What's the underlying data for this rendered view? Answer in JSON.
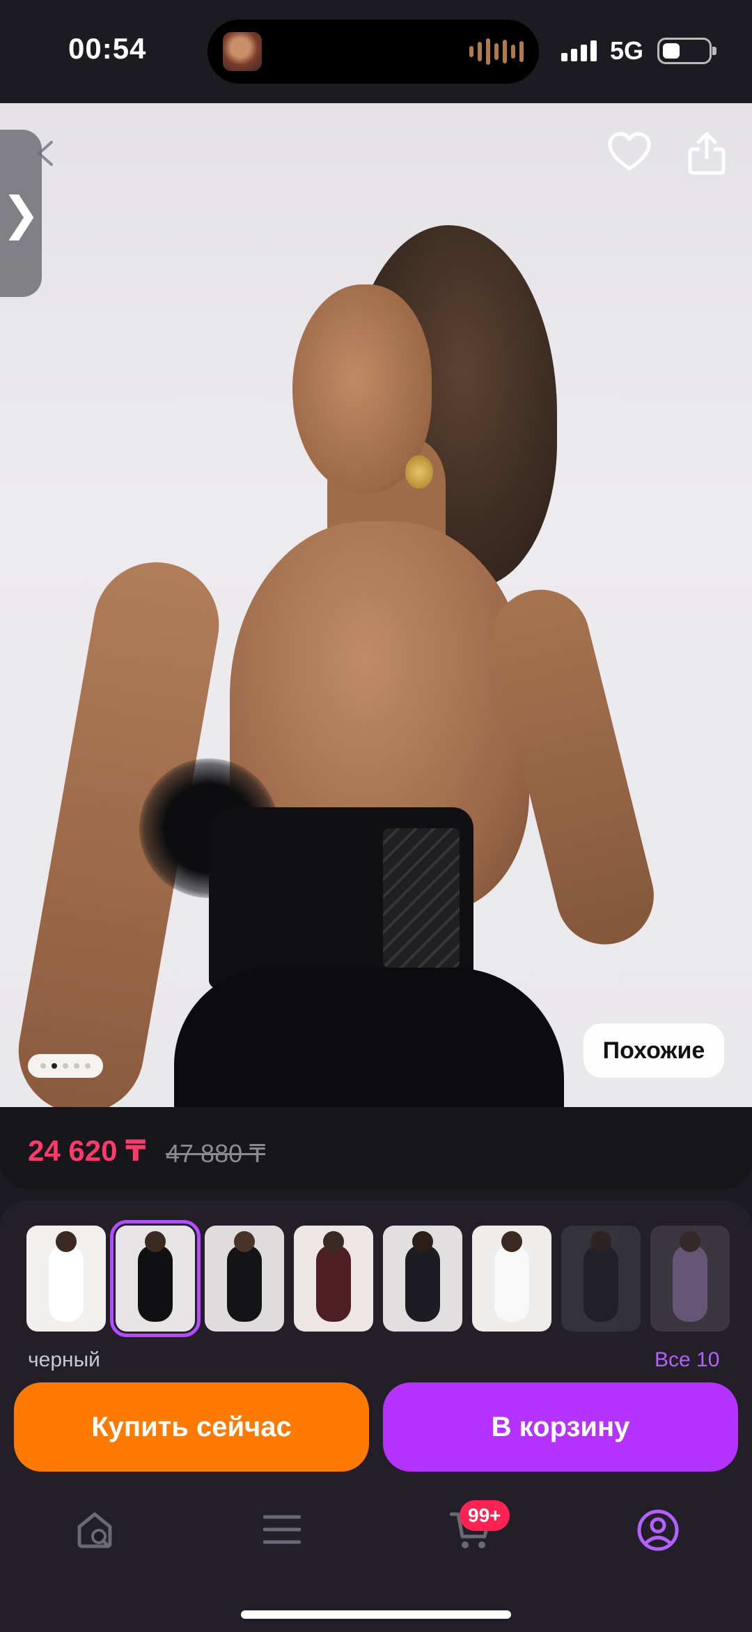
{
  "status_bar": {
    "time": "00:54",
    "network": "5G"
  },
  "product": {
    "price": "24 620 ₸",
    "old_price": "47 880 ₸",
    "image_count": 5,
    "current_image_index": 2
  },
  "image_overlay": {
    "similar_label": "Похожие"
  },
  "variants": {
    "selected_color": "черный",
    "all_label": "Все 10",
    "thumbnails": [
      {
        "bg": "#f2f0ee",
        "body": "#ffffff",
        "head": "#3b2a22"
      },
      {
        "bg": "#e7e4e6",
        "body": "#111113",
        "head": "#3b2a22"
      },
      {
        "bg": "#dedcdc",
        "body": "#141416",
        "head": "#4a3328"
      },
      {
        "bg": "#ece7e4",
        "body": "#4d1f25",
        "head": "#3b2a22"
      },
      {
        "bg": "#e1dfdf",
        "body": "#1c1c22",
        "head": "#2c1f18"
      },
      {
        "bg": "#efedec",
        "body": "#f8f8f8",
        "head": "#3b2a22"
      },
      {
        "bg": "#4a4a50",
        "body": "#222226",
        "head": "#3b2a22"
      },
      {
        "bg": "#5a5560",
        "body": "#b89ad2",
        "head": "#4a3328"
      }
    ]
  },
  "actions": {
    "buy_now": "Купить сейчас",
    "add_to_cart": "В корзину"
  },
  "bottom_nav": {
    "cart_badge": "99+"
  },
  "colors": {
    "price": "#ff3b6b",
    "buy_button": "#ff7a00",
    "cart_button": "#b433ff",
    "accent": "#b461ff"
  }
}
